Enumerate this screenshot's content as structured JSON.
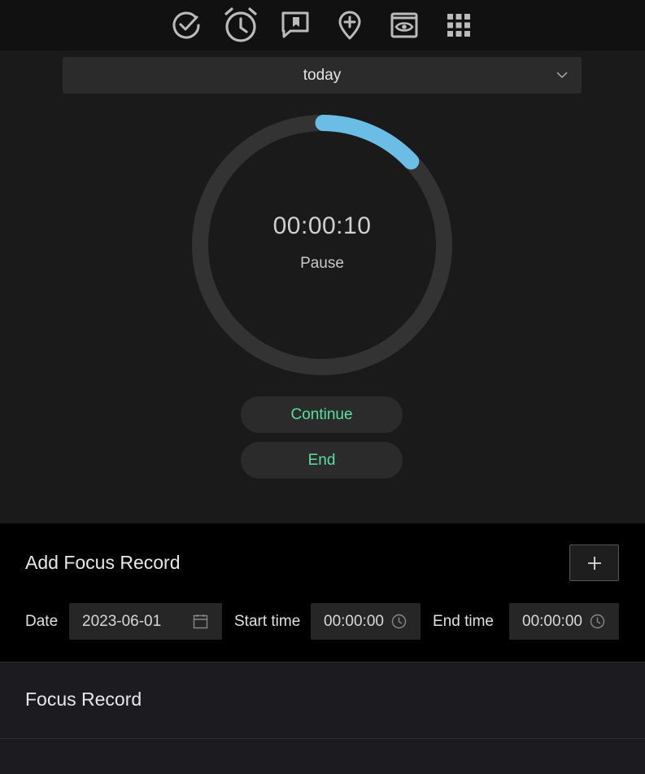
{
  "nav": {
    "icons": [
      "check-circle-icon",
      "alarm-clock-icon",
      "bookmark-message-icon",
      "map-pin-plus-icon",
      "eye-window-icon",
      "grid-apps-icon"
    ]
  },
  "timer": {
    "range_selected": "today",
    "elapsed": "00:00:10",
    "state": "Pause",
    "progress_fraction": 0.13,
    "accent_color": "#6cbde6",
    "continue_label": "Continue",
    "end_label": "End"
  },
  "add_record": {
    "title": "Add Focus Record",
    "add_icon": "plus-icon",
    "date_label": "Date",
    "date_value": "2023-06-01",
    "start_label": "Start time",
    "start_value": "00:00:00",
    "end_label": "End time",
    "end_value": "00:00:00"
  },
  "records": {
    "title": "Focus Record"
  }
}
